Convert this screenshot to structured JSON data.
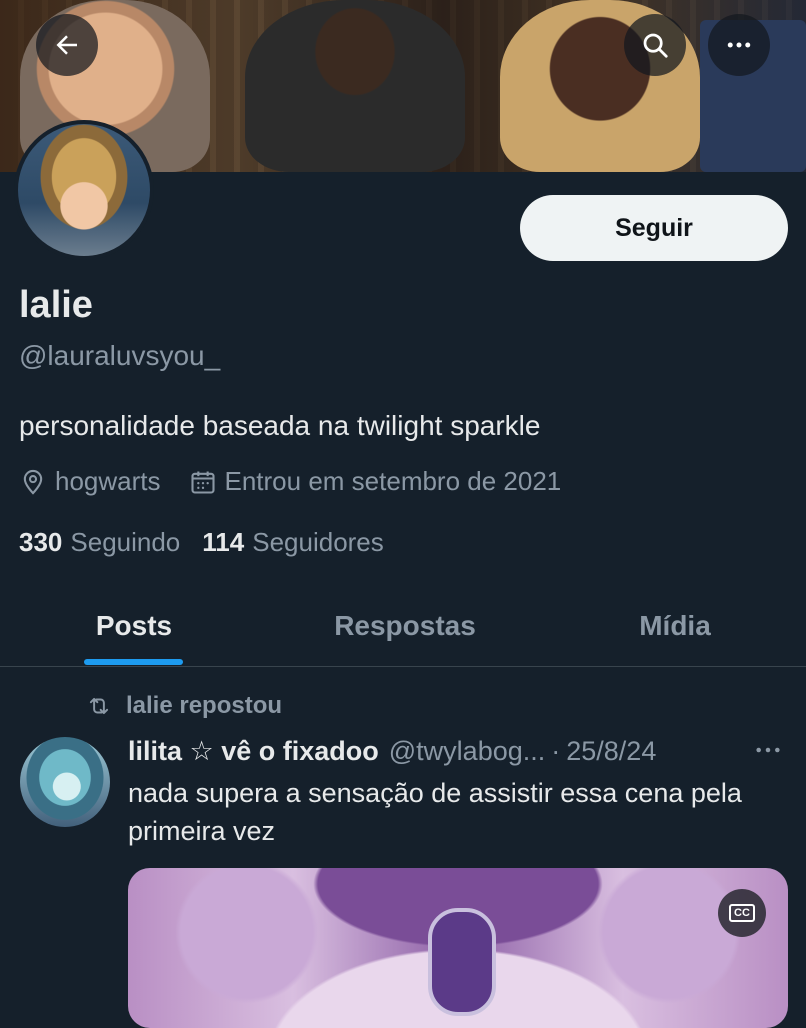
{
  "header": {
    "back_icon": "arrow-left-icon",
    "search_icon": "search-icon",
    "more_icon": "more-horizontal-icon"
  },
  "profile": {
    "follow_label": "Seguir",
    "display_name": "lalie",
    "handle": "@lauraluvsyou_",
    "bio": "personalidade baseada na twilight sparkle",
    "location": "hogwarts",
    "joined": "Entrou em setembro de 2021",
    "following_count": "330",
    "following_label": "Seguindo",
    "followers_count": "114",
    "followers_label": "Seguidores"
  },
  "tabs": [
    {
      "label": "Posts",
      "active": true
    },
    {
      "label": "Respostas",
      "active": false
    },
    {
      "label": "Mídia",
      "active": false
    }
  ],
  "feed": {
    "repost_label": "lalie repostou",
    "post": {
      "author_name": "lilita ☆ vê o fixadoo",
      "author_handle": "@twylabog...",
      "date": "25/8/24",
      "text": "nada supera a sensação de assistir essa cena pela primeira vez",
      "cc_label": "CC"
    }
  },
  "colors": {
    "background": "#15202b",
    "accent": "#1d9bf0",
    "text_primary": "#e7e9ea",
    "text_secondary": "#8b98a5"
  }
}
